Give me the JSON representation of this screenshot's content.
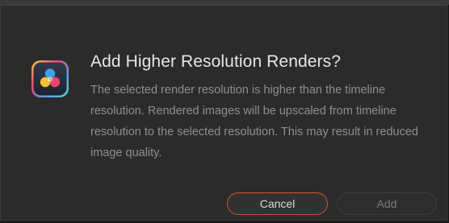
{
  "dialog": {
    "title": "Add Higher Resolution Renders?",
    "message": "The selected render resolution is higher than the timeline resolution. Rendered images will be upscaled from timeline resolution to the selected resolution. This may result in reduced image quality.",
    "icon": "davinci-resolve-app-icon"
  },
  "buttons": {
    "cancel_label": "Cancel",
    "add_label": "Add"
  },
  "colors": {
    "background": "#2b2b2b",
    "title": "#e6e6e6",
    "message": "#8e8e8e",
    "accent_border": "#d0532f"
  }
}
